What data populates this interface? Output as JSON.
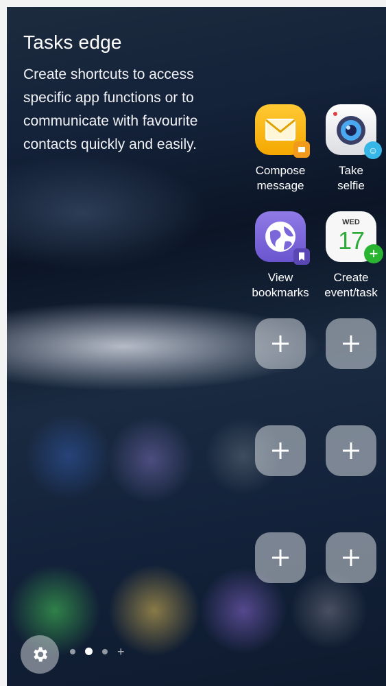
{
  "panel": {
    "title": "Tasks edge",
    "description": "Create shortcuts to access specific app functions or to communicate with favourite contacts quickly and easily."
  },
  "shortcuts": [
    {
      "label": "Compose\nmessage",
      "icon": "envelope-icon",
      "badge_icon": "message-badge-icon",
      "color": "#f7b600"
    },
    {
      "label": "Take\nselfie",
      "icon": "camera-icon",
      "badge_icon": "smiley-badge-icon",
      "color": "#e8e8ea"
    },
    {
      "label": "View\nbookmarks",
      "icon": "globe-icon",
      "badge_icon": "bookmark-badge-icon",
      "color": "#7d67d8"
    },
    {
      "label": "Create\nevent/task",
      "icon": "calendar-icon",
      "badge_icon": "add-badge-icon",
      "color": "#f5f5f5",
      "calendar_day": "WED",
      "calendar_date": "17"
    }
  ],
  "empty_slots": 6,
  "footer": {
    "settings_icon": "gear-icon",
    "page_indicator": {
      "total_dots": 3,
      "active_index": 1,
      "add_page_symbol": "+"
    }
  }
}
